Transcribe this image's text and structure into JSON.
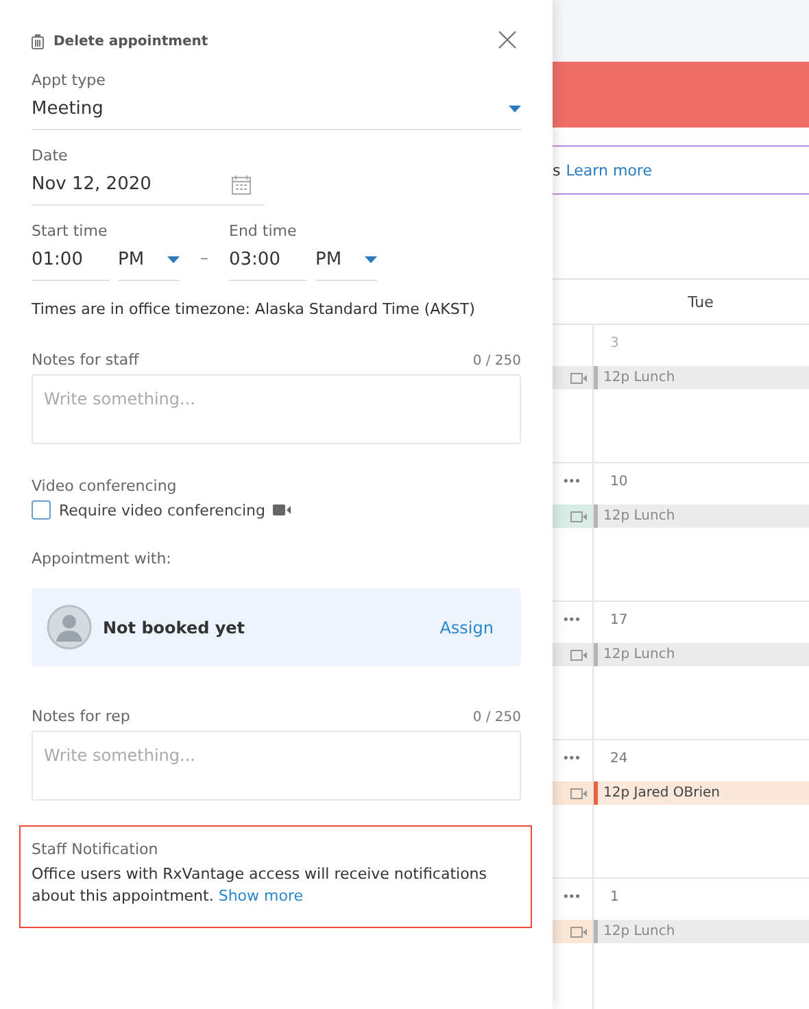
{
  "panel": {
    "delete_label": "Delete appointment",
    "appt_type": {
      "label": "Appt type",
      "value": "Meeting"
    },
    "date": {
      "label": "Date",
      "value": "Nov 12, 2020"
    },
    "start_time": {
      "label": "Start time",
      "value": "01:00",
      "period": "PM"
    },
    "separator": "–",
    "end_time": {
      "label": "End time",
      "value": "03:00",
      "period": "PM"
    },
    "timezone_note": "Times are in office timezone: Alaska Standard Time (AKST)",
    "staff_notes": {
      "label": "Notes for staff",
      "count": "0 / 250",
      "placeholder": "Write something..."
    },
    "video": {
      "label": "Video conferencing",
      "checkbox_label": "Require video conferencing",
      "checked": false
    },
    "appointment_with": {
      "label": "Appointment with:",
      "status": "Not booked yet",
      "action": "Assign"
    },
    "rep_notes": {
      "label": "Notes for rep",
      "count": "0 / 250",
      "placeholder": "Write something..."
    },
    "staff_notification": {
      "title": "Staff Notification",
      "text": "Office users with RxVantage access will receive notifications about this appointment.",
      "link": "Show more"
    }
  },
  "calendar": {
    "banner_text": "s",
    "banner_link": "Learn more",
    "day_header": "Tue",
    "weeks": [
      {
        "date": "3",
        "prev_event": {
          "color": "#ebebeb"
        },
        "event": {
          "text": "12p Lunch",
          "kind": "lunch",
          "color": "#b5b5b5"
        }
      },
      {
        "date": "10",
        "menu": "•••",
        "prev_event": {
          "color": "#d8eee4"
        },
        "event": {
          "text": "12p Lunch",
          "kind": "lunch",
          "color": "#b5b5b5"
        }
      },
      {
        "date": "17",
        "menu": "•••",
        "prev_event": {
          "color": "#ebebeb"
        },
        "event": {
          "text": "12p Lunch",
          "kind": "lunch",
          "color": "#b5b5b5"
        }
      },
      {
        "date": "24",
        "menu": "•••",
        "prev_event": {
          "color": "#fbe6d6"
        },
        "event": {
          "text": "12p Jared OBrien",
          "kind": "booked",
          "color": "#e8643c"
        }
      },
      {
        "date": "1",
        "menu": "•••",
        "prev_event": {
          "color": "#fbe6d6"
        },
        "event": {
          "text": "12p Lunch",
          "kind": "lunch",
          "color": "#b5b5b5"
        }
      }
    ]
  }
}
